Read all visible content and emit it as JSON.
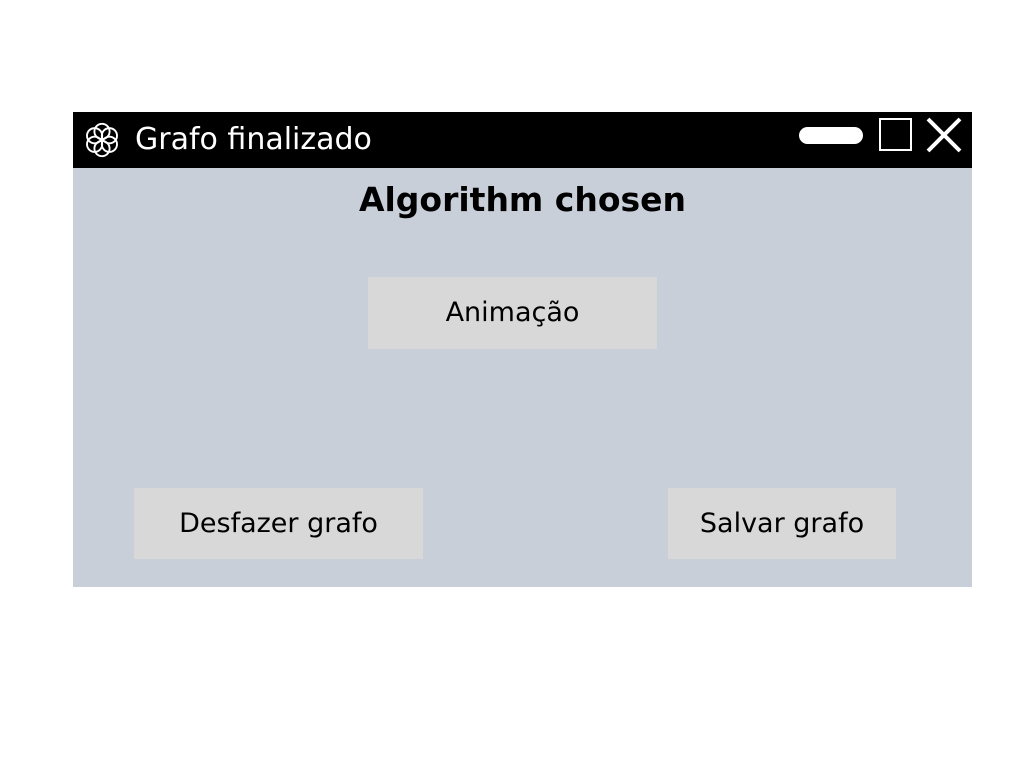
{
  "window": {
    "title": "Grafo finalizado",
    "app_icon": "flower-icon",
    "controls": {
      "minimize_icon": "minimize-icon",
      "maximize_icon": "maximize-icon",
      "close_icon": "close-icon"
    }
  },
  "content": {
    "heading": "Algorithm chosen",
    "animation_label": "Animação",
    "undo_label": "Desfazer grafo",
    "save_label": "Salvar grafo"
  },
  "colors": {
    "titlebar": "#000000",
    "window_background": "#c8cfd9",
    "button_background": "#d8d8d8"
  }
}
